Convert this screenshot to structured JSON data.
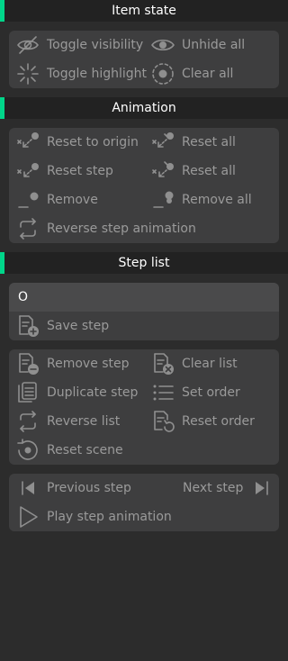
{
  "item_state": {
    "title": "Item state",
    "toggle_visibility": "Toggle visibility",
    "unhide_all": "Unhide all",
    "toggle_highlight": "Toggle highlight",
    "clear_all": "Clear all"
  },
  "animation": {
    "title": "Animation",
    "reset_to_origin": "Reset to origin",
    "reset_all_1": "Reset all",
    "reset_step": "Reset step",
    "reset_all_2": "Reset all",
    "remove": "Remove",
    "remove_all": "Remove all",
    "reverse_step_animation": "Reverse step animation"
  },
  "step_list": {
    "title": "Step list",
    "input_value": "O",
    "save_step": "Save step",
    "remove_step": "Remove step",
    "clear_list": "Clear list",
    "duplicate_step": "Duplicate step",
    "set_order": "Set order",
    "reverse_list": "Reverse list",
    "reset_order": "Reset order",
    "reset_scene": "Reset scene",
    "previous_step": "Previous step",
    "next_step": "Next step",
    "play_step_animation": "Play step animation"
  },
  "colors": {
    "accent": "#00d68a",
    "header_bg": "#222222",
    "panel_bg": "#3e3e3f",
    "page_bg": "#2c2c2c"
  }
}
